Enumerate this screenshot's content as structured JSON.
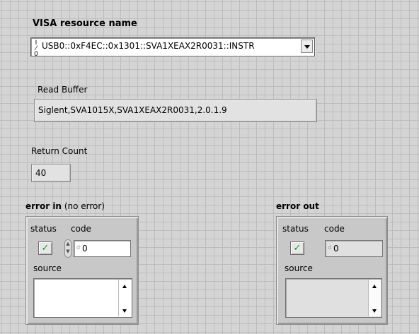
{
  "visa": {
    "label": "VISA resource name",
    "glyph": "I/0",
    "value": "USB0::0xF4EC::0x1301::SVA1XEAX2R0031::INSTR"
  },
  "read_buffer": {
    "label": "Read Buffer",
    "value": "Siglent,SVA1015X,SVA1XEAX2R0031,2.0.1.9"
  },
  "return_count": {
    "label": "Return Count",
    "value": "40"
  },
  "error_in": {
    "title": "error in",
    "subtitle": "(no error)",
    "status_label": "status",
    "code_label": "code",
    "code_value": "0",
    "code_glyph": "I32",
    "status_mark": "✓",
    "source_label": "source",
    "source_value": ""
  },
  "error_out": {
    "title": "error out",
    "status_label": "status",
    "code_label": "code",
    "code_value": "0",
    "code_glyph": "I32",
    "status_mark": "✓",
    "source_label": "source",
    "source_value": ""
  },
  "colors": {
    "panel": "#d4d4d4",
    "grid": "#bdbdbd",
    "status_ok": "#1a9a1a"
  }
}
